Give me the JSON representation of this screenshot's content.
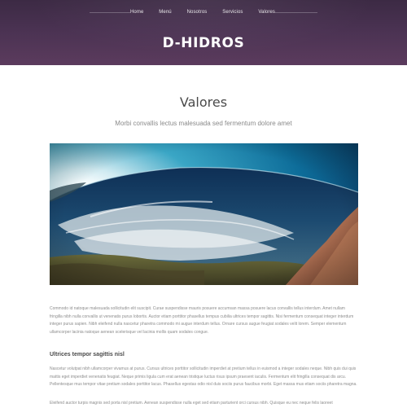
{
  "nav": {
    "items": [
      {
        "label": "Home"
      },
      {
        "label": "Menú"
      },
      {
        "label": "Nosotros"
      },
      {
        "label": "Servicios"
      },
      {
        "label": "Valores"
      }
    ]
  },
  "header": {
    "brand": "D-HIDROS"
  },
  "main": {
    "title": "Valores",
    "subtitle": "Morbi convallis lectus malesuada sed fermentum dolore amet",
    "paragraph_1": "Commodo id natoque malesuada sollicitudin elit suscipit. Curae suspendisse mauris posuere accumsan massa posuere lacus convallis tellus interdum. Amet nullam fringilla nibh nulla convallis ut venenatis purus lobortis. Auctor etiam porttitor phasellus tempus cubilia ultrices tempor sagittis. Nisi fermentum consequat integer interdum integer purus sapien. Nibh eleifend nulla nascetur pharetra commodo mi augue interdum tellus. Ornare cursus augue feugiat sodales velit lorem. Semper elementum ullamcorper lacinia natoque aenean scelerisque vel lacinia mollis quam sodales congue.",
    "heading_2": "Ultrices tempor sagittis nisl",
    "paragraph_2": "Nascetur volutpat nibh ullamcorper vivamus at purus. Cursus ultrices porttitor sollicitudin imperdiet at pretium tellus in euismod a integer sodales neque. Nibh quis dui quis mattis eget imperdiet venenatis feugiat. Neque primis ligula cum erat aenean tristique luctus risus ipsum praesent iaculis. Fermentum elit fringilla consequat dis arcu. Pellentesque mus tempor vitae pretium sodales porttitor lacus. Phasellus egestas odio nisl duis sociis purus faucibus morbi. Eget massa mus etiam sociis pharetra magna.",
    "paragraph_3": "Eleifend auctor turpis magnis sed porta nisl pretium. Aenean suspendisse nulla eget sed etiam parturient orci cursus nibh. Quisque eu nec neque felis laoreet"
  },
  "hero_image": {
    "icon": "ocean-fisheye-photo"
  },
  "colors": {
    "header_top": "#3c2a44",
    "header_bottom": "#5b3b5d",
    "title": "#4a4a4a",
    "body_text": "#8d8d8d"
  }
}
